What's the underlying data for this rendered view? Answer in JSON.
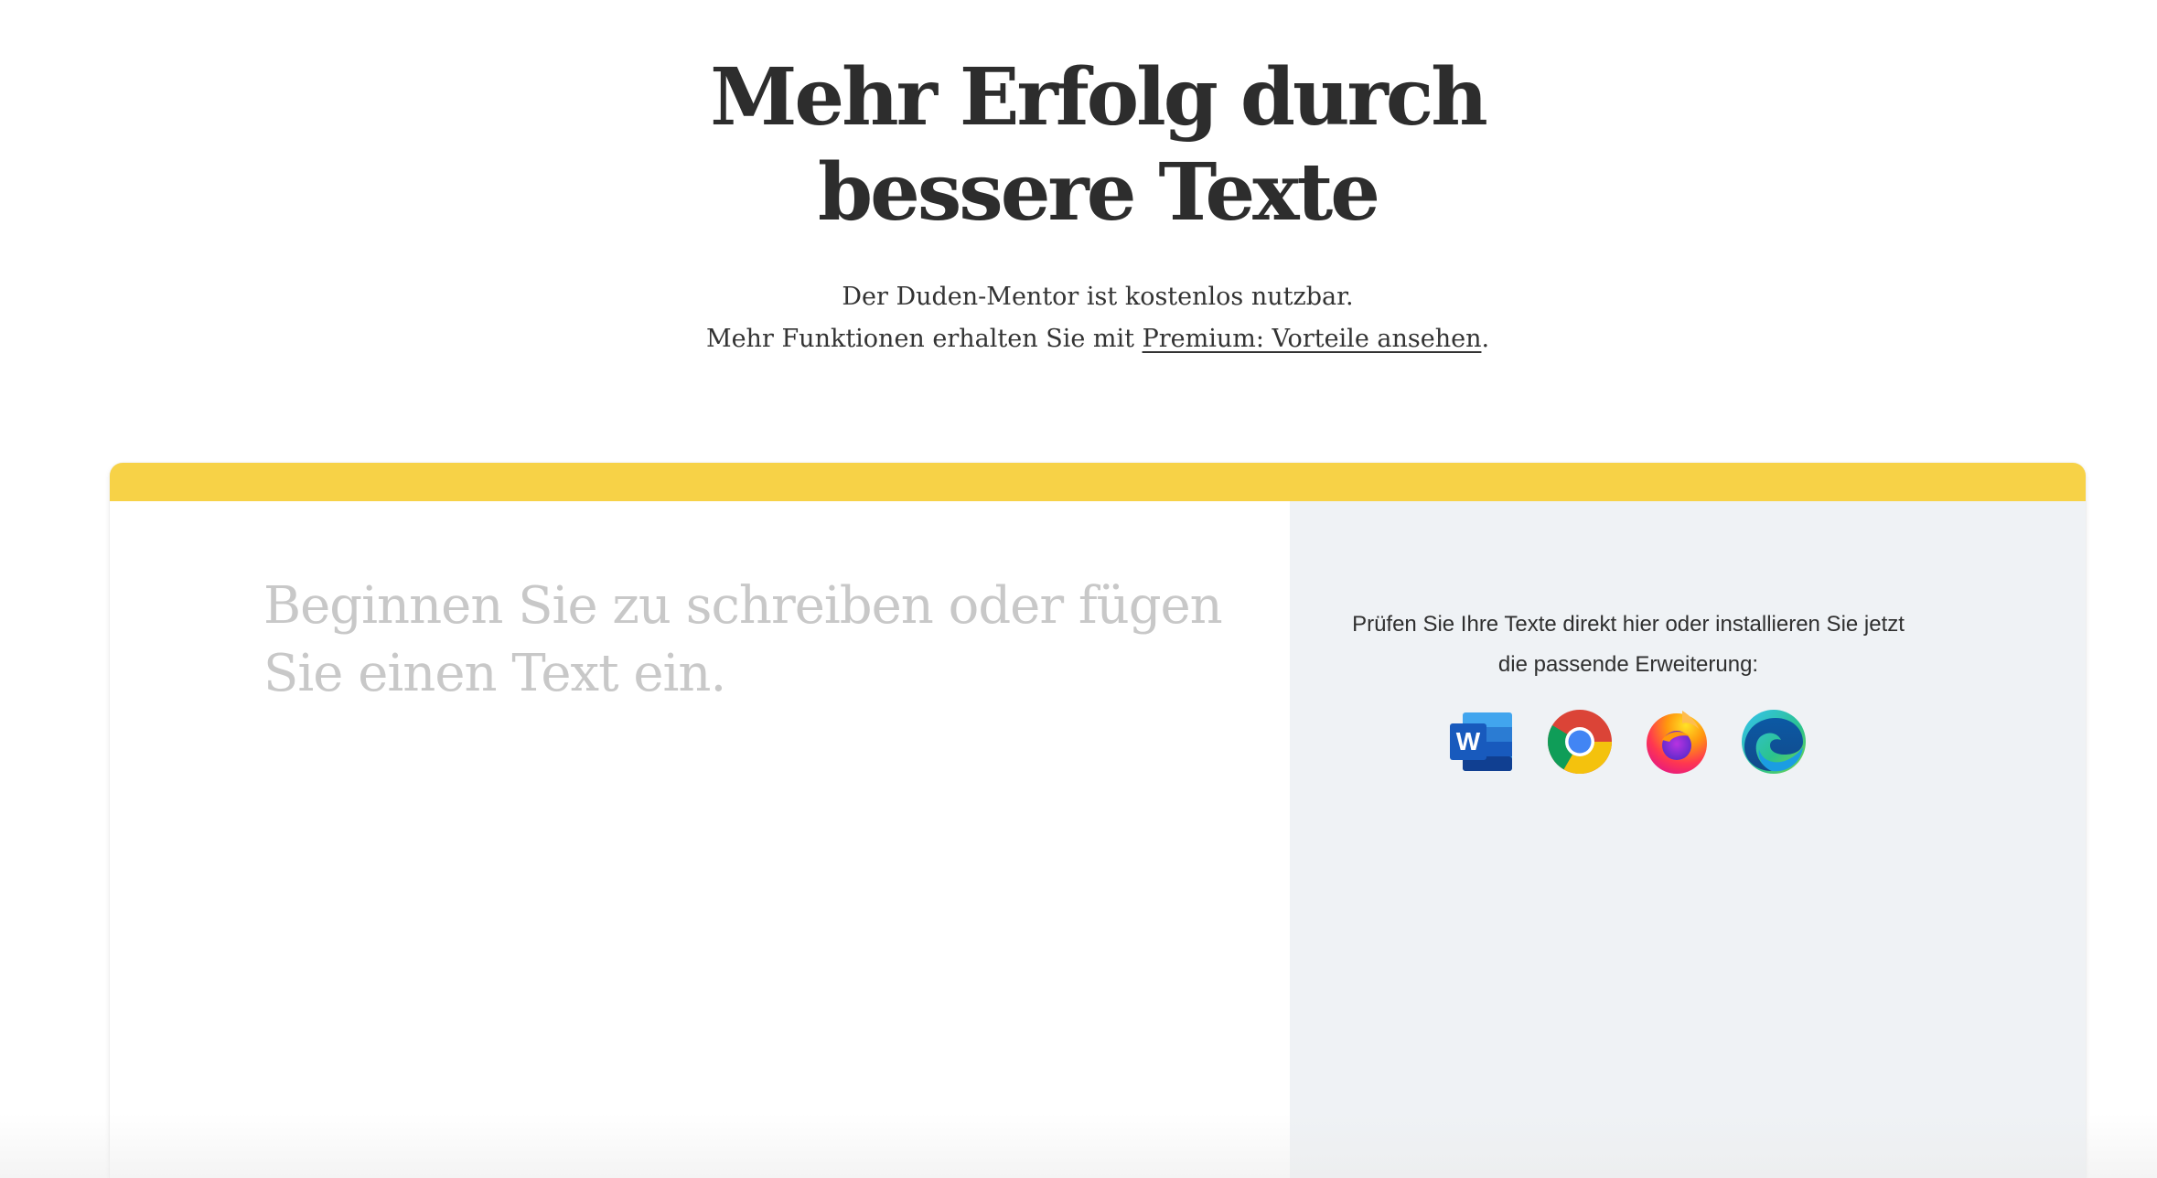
{
  "hero": {
    "title_line1": "Mehr Erfolg durch",
    "title_line2": "bessere Texte",
    "subtitle_line1": "Der Duden-Mentor ist kostenlos nutzbar.",
    "subtitle_line2_prefix": "Mehr Funktionen erhalten Sie mit ",
    "premium_link": "Premium: Vorteile ansehen",
    "subtitle_line2_suffix": "."
  },
  "editor": {
    "placeholder": "Beginnen Sie zu schreiben oder fügen Sie einen Text ein."
  },
  "sidebar": {
    "info_line1": "Prüfen Sie Ihre Texte direkt hier oder installieren Sie jetzt",
    "info_line2": "die passende Erweiterung:",
    "extensions": [
      {
        "icon": "word-icon",
        "label": "W"
      },
      {
        "icon": "chrome-icon"
      },
      {
        "icon": "firefox-icon"
      },
      {
        "icon": "edge-icon"
      }
    ]
  },
  "colors": {
    "accent_yellow": "#f7d247",
    "sidebar_bg": "#eff2f5",
    "placeholder_text": "#c8c8c8",
    "heading_text": "#2d2d2d"
  }
}
